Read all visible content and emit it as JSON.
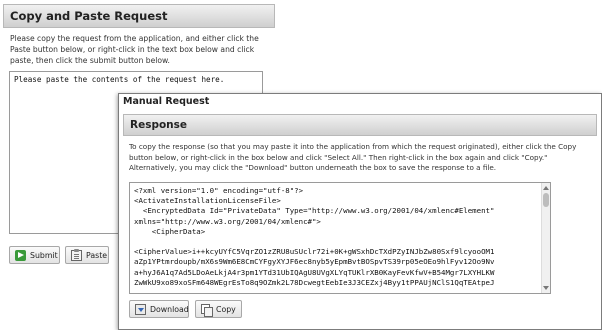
{
  "copy_paste": {
    "header": "Copy and Paste Request",
    "description": "Please copy the request from the application, and either click the Paste button below, or right-click in the text box below and click paste, then click the submit button below.",
    "textarea_value": "Please paste the contents of the request here.",
    "submit_label": "Submit",
    "paste_label": "Paste"
  },
  "manual_request": {
    "title": "Manual Request",
    "response_header": "Response",
    "description": "To copy the response (so that you may paste it into the application from which the request originated), either click the Copy button below, or right-click in the box below and click \"Select All.\" Then right-click in the box again and click \"Copy.\" Alternatively, you may click the \"Download\" button underneath the box to save the response to a file.",
    "response_lines": [
      "<?xml version=\"1.0\" encoding=\"utf-8\"?>",
      "<ActivateInstallationLicenseFile>",
      "  <EncryptedData Id=\"PrivateData\" Type=\"http://www.w3.org/2001/04/xmlenc#Element\"",
      "xmlns=\"http://www.w3.org/2001/04/xmlenc#\">",
      "    <CipherData>",
      "",
      "<CipherValue>i++kcyUYfC5VqrZO1zZRU8uSUclr72i+0K+gWSxhDcTXdPZyINJbZw80Sxf9lcyooOM1",
      "aZp1YPtmrdoupb/mX6s9Wm6E8CmCYFgyXYJF6ec8nyb5yEpmBvtBOSpvTS39rp05eOEo9hlFyv12Oo9Nv",
      "a+hyJ6A1q7Ad5LDoAeLkjA4r3pm1YTd31UbIQAgU8UVgXLYqTUKlrXB0KayFevKfwV+B54Mgr7LXYHLKW",
      "ZwWkU9xo89xoSFm648WEgrEsTo8q9OZmk2L78DcwegtEebIe3J3CEZxj4Byy1tPPAUjNClS1QqTEAtpeJ"
    ],
    "download_label": "Download",
    "copy_label": "Copy"
  }
}
